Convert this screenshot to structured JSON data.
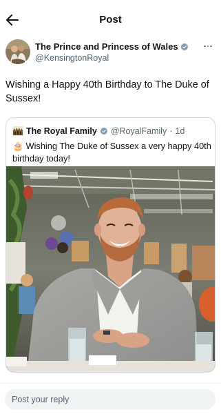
{
  "header": {
    "title": "Post"
  },
  "author": {
    "name": "The Prince and Princess of Wales",
    "handle": "@KensingtonRoyal"
  },
  "post": {
    "text": "Wishing a Happy 40th Birthday to The Duke of Sussex!"
  },
  "quote": {
    "name": "The Royal Family",
    "handle": "@RoyalFamily",
    "separator": "·",
    "time": "1d",
    "text": "Wishing The Duke of Sussex a very happy 40th birthday today!",
    "emoji": "🎂"
  },
  "reply": {
    "placeholder": "Post your reply"
  },
  "colors": {
    "verified": "#829aab",
    "text": "#0f1419",
    "secondary": "#536471",
    "border": "#cfd9de"
  }
}
